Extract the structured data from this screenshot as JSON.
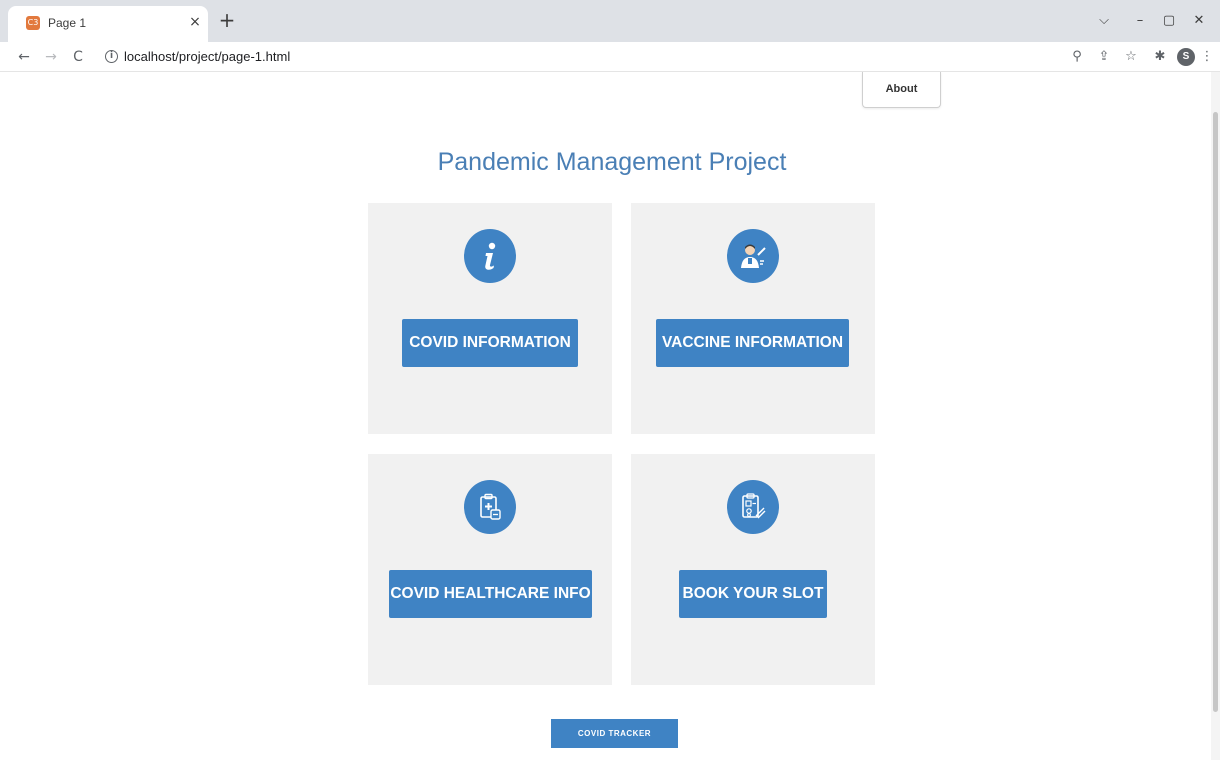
{
  "browser": {
    "tab_title": "Page 1",
    "tab_favicon": "C3",
    "tab_close": "×",
    "new_tab": "+",
    "url": "localhost/project/page-1.html",
    "profile_initial": "S",
    "icons": {
      "back": "←",
      "forward": "→",
      "reload": "C",
      "zoom": "⚲",
      "share": "⇪",
      "star": "☆",
      "extensions": "✱",
      "menu": "⋮",
      "chevron": "⌵",
      "minimize": "–",
      "maximize": "▢",
      "close": "✕"
    }
  },
  "nav": {
    "about_label": "About"
  },
  "page": {
    "title": "Pandemic Management Project"
  },
  "cards": [
    {
      "label": "COVID INFORMATION",
      "icon": "info-icon"
    },
    {
      "label": "VACCINE INFORMATION",
      "icon": "vaccine-icon"
    },
    {
      "label": "COVID HEALTHCARE INFO",
      "icon": "clipboard-icon"
    },
    {
      "label": "BOOK YOUR SLOT",
      "icon": "booking-icon"
    }
  ],
  "footer": {
    "tracker_label": "COVID TRACKER"
  },
  "colors": {
    "accent": "#3f83c4",
    "title": "#4a7fb5",
    "card_bg": "#f1f1f1"
  }
}
